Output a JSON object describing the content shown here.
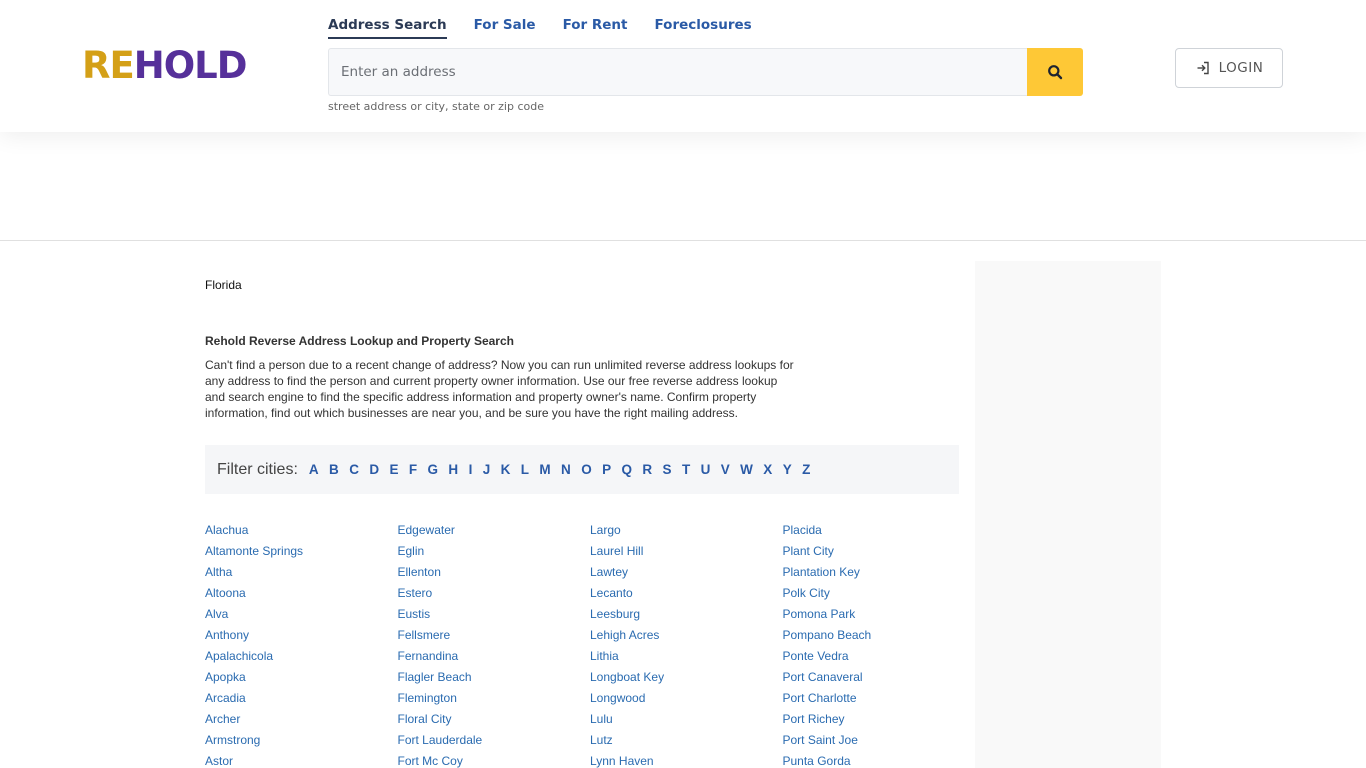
{
  "header": {
    "logo_part1": "RE",
    "logo_part2": "HOLD",
    "tabs": [
      {
        "label": "Address Search",
        "active": true
      },
      {
        "label": "For Sale"
      },
      {
        "label": "For Rent"
      },
      {
        "label": "Foreclosures"
      }
    ],
    "search": {
      "placeholder": "Enter an address",
      "value": "",
      "hint": "street address or city, state or zip code",
      "button_icon": "search-icon"
    },
    "login": {
      "label": "LOGIN",
      "icon": "login-icon"
    }
  },
  "breadcrumb": "Florida",
  "intro": {
    "title": "Rehold Reverse Address Lookup and Property Search",
    "text": "Can't find a person due to a recent change of address? Now you can run unlimited reverse address lookups for any address to find the person and current property owner information. Use our free reverse address lookup and search engine to find the specific address information and property owner's name. Confirm property information, find out which businesses are near you, and be sure you have the right mailing address."
  },
  "filter": {
    "label": "Filter cities:",
    "letters": [
      "A",
      "B",
      "C",
      "D",
      "E",
      "F",
      "G",
      "H",
      "I",
      "J",
      "K",
      "L",
      "M",
      "N",
      "O",
      "P",
      "Q",
      "R",
      "S",
      "T",
      "U",
      "V",
      "W",
      "X",
      "Y",
      "Z"
    ]
  },
  "cities": [
    [
      "Alachua",
      "Altamonte Springs",
      "Altha",
      "Altoona",
      "Alva",
      "Anthony",
      "Apalachicola",
      "Apopka",
      "Arcadia",
      "Archer",
      "Armstrong",
      "Astor"
    ],
    [
      "Edgewater",
      "Eglin",
      "Ellenton",
      "Estero",
      "Eustis",
      "Fellsmere",
      "Fernandina",
      "Flagler Beach",
      "Flemington",
      "Floral City",
      "Fort Lauderdale",
      "Fort Mc Coy"
    ],
    [
      "Largo",
      "Laurel Hill",
      "Lawtey",
      "Lecanto",
      "Leesburg",
      "Lehigh Acres",
      "Lithia",
      "Longboat Key",
      "Longwood",
      "Lulu",
      "Lutz",
      "Lynn Haven"
    ],
    [
      "Placida",
      "Plant City",
      "Plantation Key",
      "Polk City",
      "Pomona Park",
      "Pompano Beach",
      "Ponte Vedra",
      "Port Canaveral",
      "Port Charlotte",
      "Port Richey",
      "Port Saint Joe",
      "Punta Gorda"
    ]
  ],
  "colors": {
    "brand_gold": "#d4a017",
    "brand_purple": "#56309a",
    "link": "#2a6bb0",
    "search_button": "#fec836"
  }
}
